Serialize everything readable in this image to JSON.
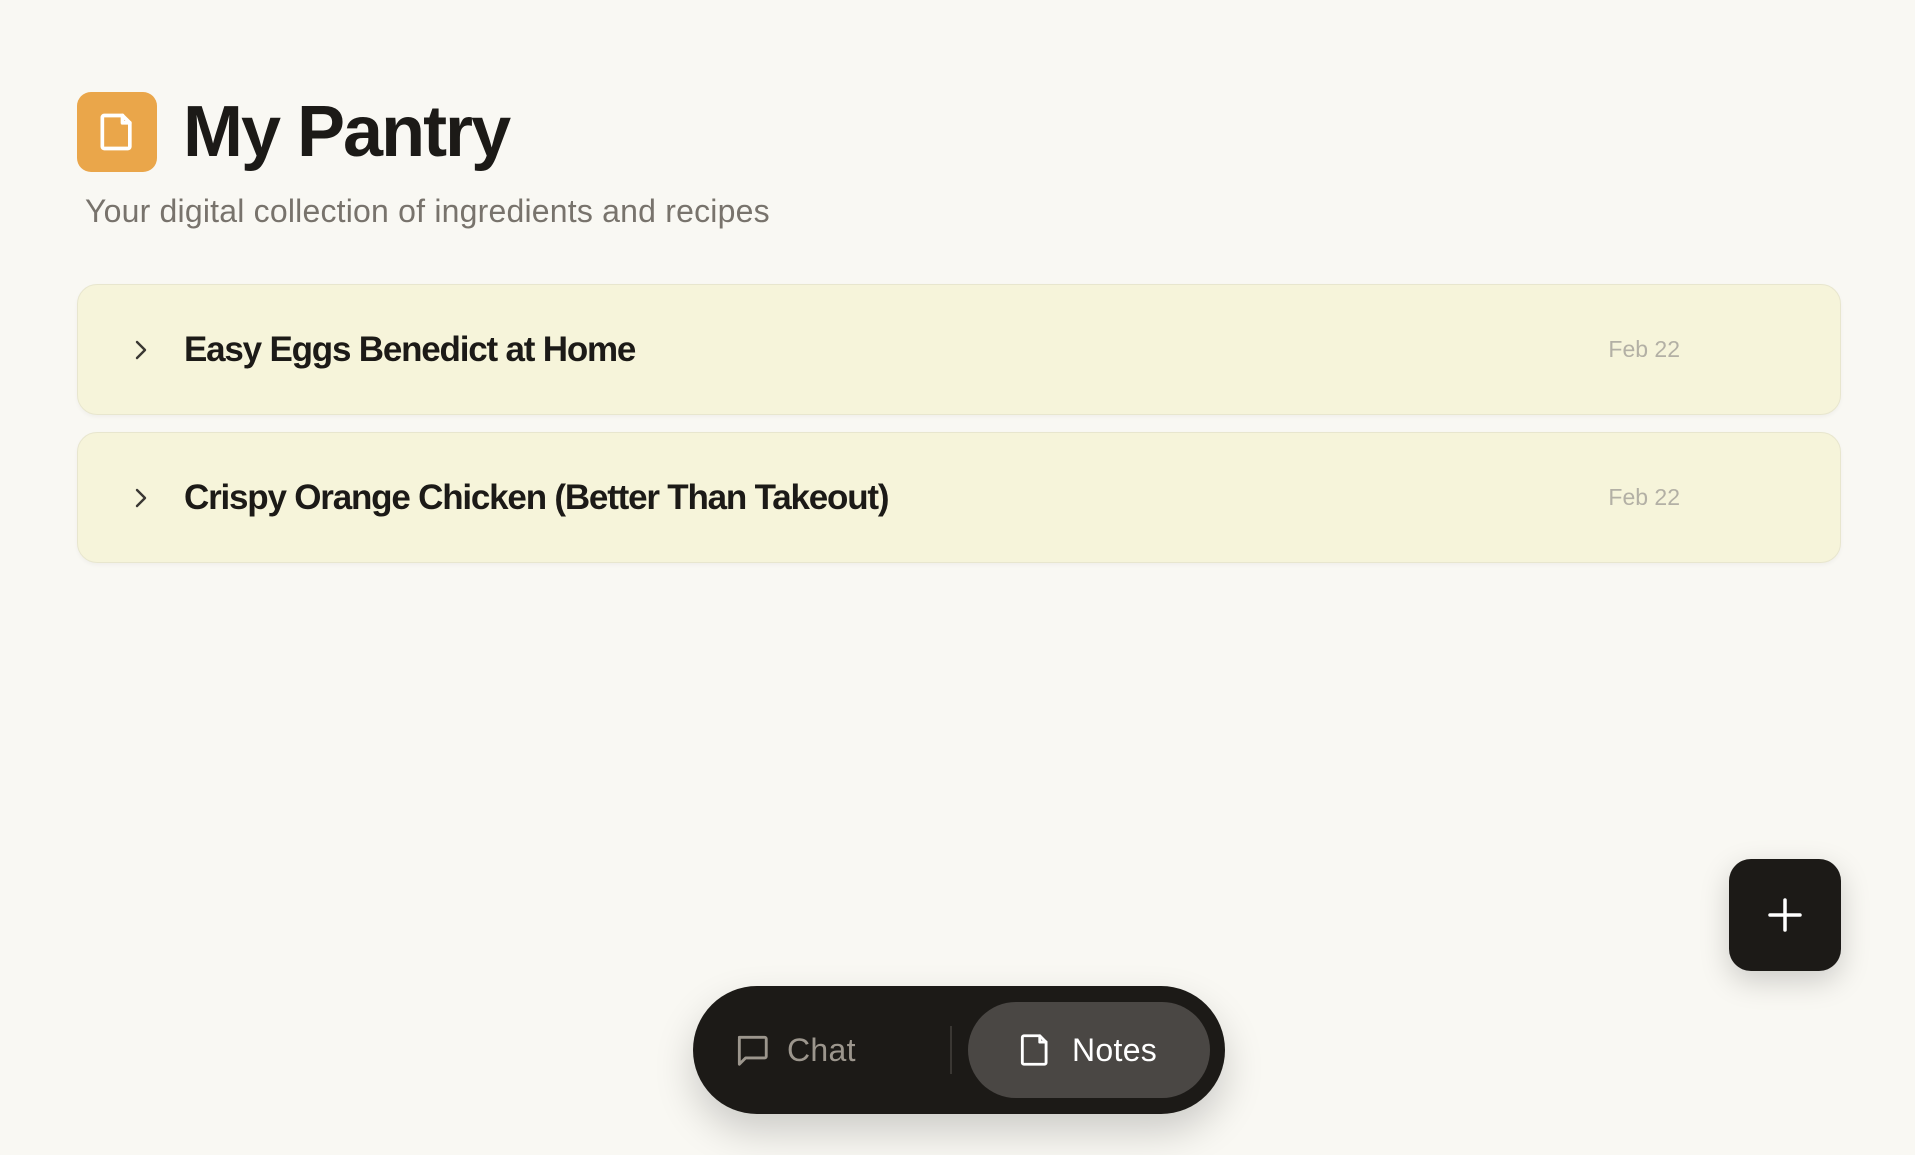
{
  "header": {
    "title": "My Pantry",
    "subtitle": "Your digital collection of ingredients and recipes",
    "icon": "note-icon",
    "icon_color": "#eaa64a"
  },
  "notes": [
    {
      "title": "Easy Eggs Benedict at Home",
      "date": "Feb 22",
      "expanded": false
    },
    {
      "title": "Crispy Orange Chicken (Better Than Takeout)",
      "date": "Feb 22",
      "expanded": false
    }
  ],
  "fab": {
    "icon": "plus-icon"
  },
  "bottom_nav": {
    "items": [
      {
        "label": "Chat",
        "icon": "chat-bubble-icon",
        "active": false
      },
      {
        "label": "Notes",
        "icon": "note-icon",
        "active": true
      }
    ]
  },
  "colors": {
    "background": "#f9f8f3",
    "card": "#f6f4da",
    "dark": "#1c1a17",
    "accent": "#eaa64a"
  }
}
